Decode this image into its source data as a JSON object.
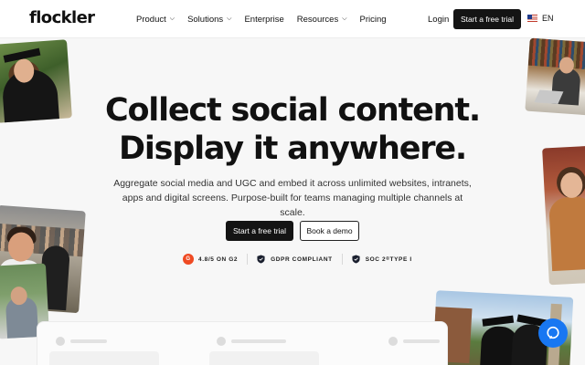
{
  "header": {
    "logo": "flockler",
    "nav": [
      {
        "label": "Product",
        "dropdown": true
      },
      {
        "label": "Solutions",
        "dropdown": true
      },
      {
        "label": "Enterprise",
        "dropdown": false
      },
      {
        "label": "Resources",
        "dropdown": true
      },
      {
        "label": "Pricing",
        "dropdown": false
      }
    ],
    "login_label": "Login",
    "trial_label": "Start a free trial",
    "language": "EN"
  },
  "hero": {
    "headline_line1": "Collect social content.",
    "headline_line2": "Display it anywhere.",
    "subtext_line1": "Aggregate social media and UGC and embed it across unlimited websites, intranets,",
    "subtext_line2": "apps and digital screens. Purpose-built for teams managing multiple channels at scale.",
    "cta_primary": "Start a free trial",
    "cta_secondary": "Book a demo"
  },
  "badges": {
    "g2_mark": "G",
    "g2_rating": "4.8/5 ON G2",
    "gdpr": "GDPR COMPLIANT",
    "soc2": "SOC 2",
    "soc2_super": "®",
    "soc2_type": " TYPE I"
  },
  "colors": {
    "primary_button": "#141414",
    "g2_red": "#ef4a23",
    "chat_blue": "#1877f2"
  },
  "icons": [
    "chevron-down-icon",
    "us-flag-icon",
    "g2-logo-icon",
    "shield-icon",
    "chat-bubble-icon"
  ]
}
